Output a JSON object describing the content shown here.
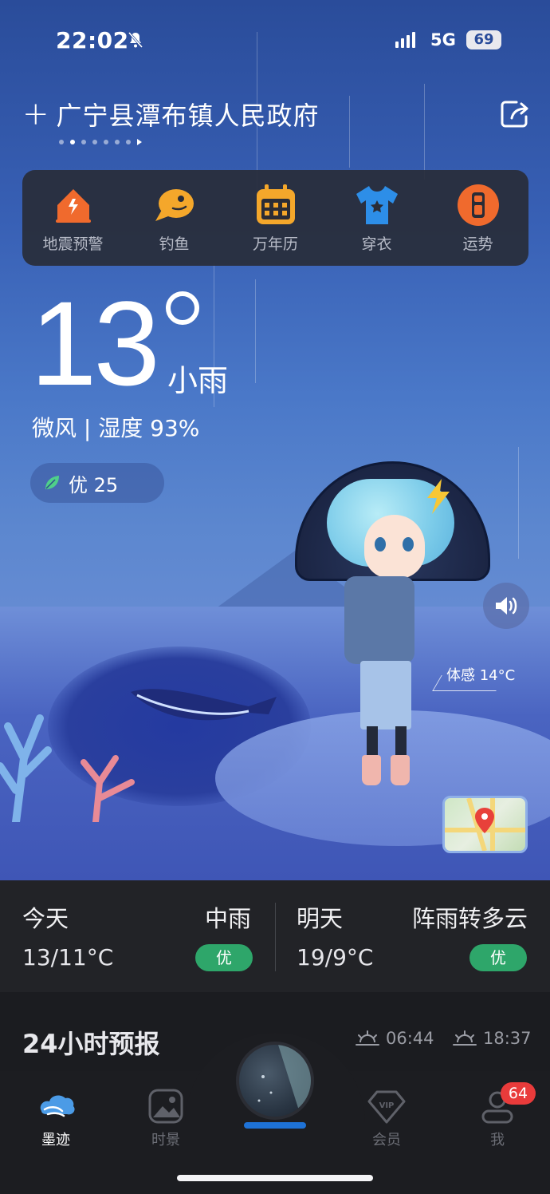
{
  "status": {
    "time": "22:02",
    "network": "5G",
    "battery": "69"
  },
  "location": {
    "name": "广宁县潭布镇人民政府",
    "plus": "+"
  },
  "tools": [
    {
      "label": "地震预警",
      "icon": "earthquake-house-icon"
    },
    {
      "label": "钓鱼",
      "icon": "fish-icon"
    },
    {
      "label": "万年历",
      "icon": "calendar-icon"
    },
    {
      "label": "穿衣",
      "icon": "tshirt-icon"
    },
    {
      "label": "运势",
      "icon": "fortune-icon"
    }
  ],
  "current": {
    "temperature": "13",
    "condition": "小雨",
    "wind_humidity": "微风 | 湿度 93%",
    "aqi": "优 25",
    "feels_like": "体感 14°C"
  },
  "forecast": {
    "today": {
      "day": "今天",
      "condition": "中雨",
      "temp": "13/11°C",
      "aqi": "优"
    },
    "tomorrow": {
      "day": "明天",
      "condition": "阵雨转多云",
      "temp": "19/9°C",
      "aqi": "优"
    }
  },
  "hourly": {
    "title": "24小时预报",
    "sunrise": "06:44",
    "sunset": "18:37"
  },
  "tabs": [
    {
      "label": "墨迹",
      "icon": "moji-cloud-icon"
    },
    {
      "label": "时景",
      "icon": "gallery-icon"
    },
    {
      "label": "会员",
      "icon": "vip-icon"
    },
    {
      "label": "我",
      "icon": "profile-icon"
    }
  ],
  "profile_badge": "64",
  "colors": {
    "accent": "#1e72d6",
    "aqi_good": "#2ea66a",
    "badge": "#e93b3b"
  }
}
